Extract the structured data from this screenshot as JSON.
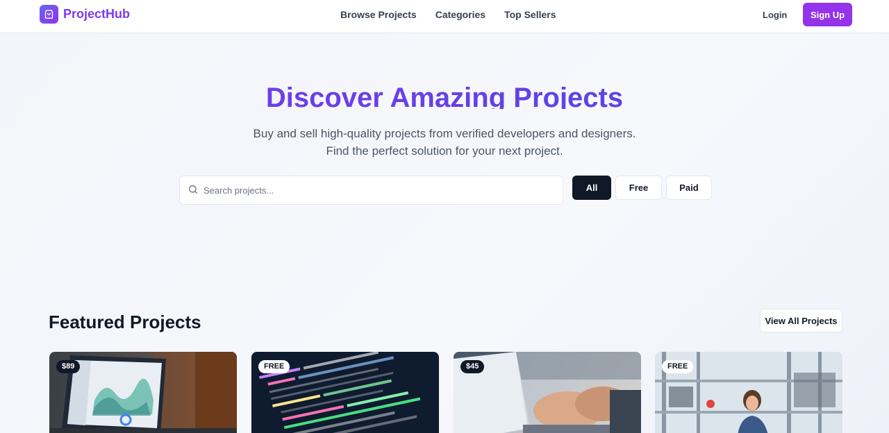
{
  "brand": {
    "name": "ProjectHub",
    "logo_icon": "shopping-bag-icon",
    "accent": "#9333ea"
  },
  "nav": {
    "items": [
      "Browse Projects",
      "Categories",
      "Top Sellers"
    ]
  },
  "auth": {
    "login": "Login",
    "signup": "Sign Up"
  },
  "hero": {
    "title": "Discover Amazing Projects",
    "subtitle_line1": "Buy and sell high-quality projects from verified developers and designers.",
    "subtitle_line2": "Find the perfect solution for your next project."
  },
  "search": {
    "placeholder": "Search projects...",
    "value": ""
  },
  "filters": [
    {
      "label": "All",
      "active": true
    },
    {
      "label": "Free",
      "active": false
    },
    {
      "label": "Paid",
      "active": false
    }
  ],
  "featured": {
    "title": "Featured Projects",
    "view_all": "View All Projects",
    "cards": [
      {
        "badge": "$89",
        "image": "laptop-dashboard"
      },
      {
        "badge": "FREE",
        "image": "code-editor"
      },
      {
        "badge": "$45",
        "image": "typing-laptop"
      },
      {
        "badge": "FREE",
        "image": "lab-engineer"
      }
    ]
  }
}
